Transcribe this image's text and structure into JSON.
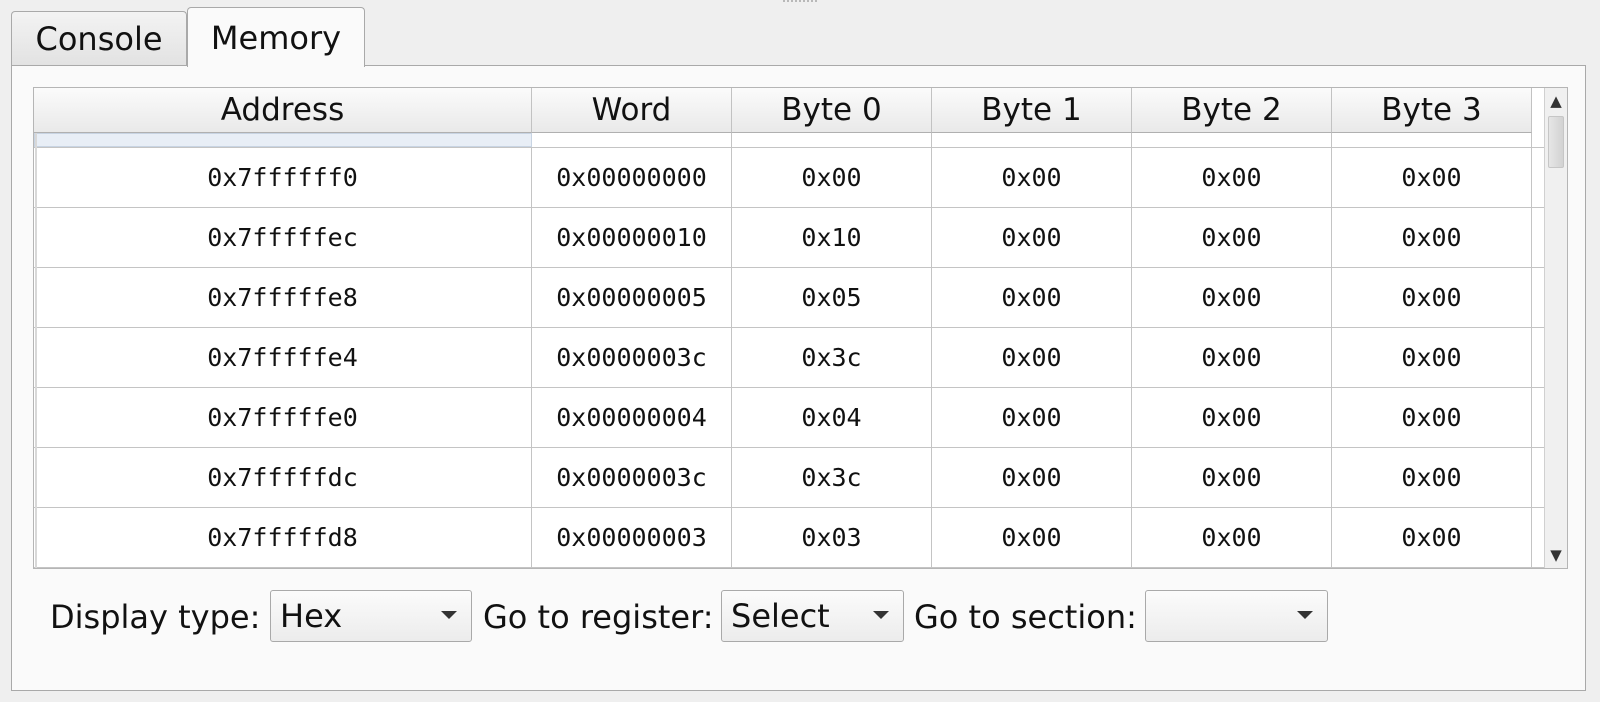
{
  "tabs": [
    {
      "label": "Console"
    },
    {
      "label": "Memory"
    }
  ],
  "table": {
    "columns": [
      "Address",
      "Word",
      "Byte 0",
      "Byte 1",
      "Byte 2",
      "Byte 3"
    ],
    "rows": [
      [
        "0x7ffffff0",
        "0x00000000",
        "0x00",
        "0x00",
        "0x00",
        "0x00"
      ],
      [
        "0x7fffffec",
        "0x00000010",
        "0x10",
        "0x00",
        "0x00",
        "0x00"
      ],
      [
        "0x7fffffe8",
        "0x00000005",
        "0x05",
        "0x00",
        "0x00",
        "0x00"
      ],
      [
        "0x7fffffe4",
        "0x0000003c",
        "0x3c",
        "0x00",
        "0x00",
        "0x00"
      ],
      [
        "0x7fffffe0",
        "0x00000004",
        "0x04",
        "0x00",
        "0x00",
        "0x00"
      ],
      [
        "0x7fffffdc",
        "0x0000003c",
        "0x3c",
        "0x00",
        "0x00",
        "0x00"
      ],
      [
        "0x7fffffd8",
        "0x00000003",
        "0x03",
        "0x00",
        "0x00",
        "0x00"
      ]
    ]
  },
  "controls": {
    "display_type_label": "Display type:",
    "display_type_value": "Hex",
    "go_to_register_label": "Go to register:",
    "go_to_register_value": "Select",
    "go_to_section_label": "Go to section:",
    "go_to_section_value": ""
  },
  "icons": {
    "scroll_up": "triangle-up-icon",
    "scroll_down": "triangle-down-icon",
    "dropdown": "chevron-down-icon"
  }
}
